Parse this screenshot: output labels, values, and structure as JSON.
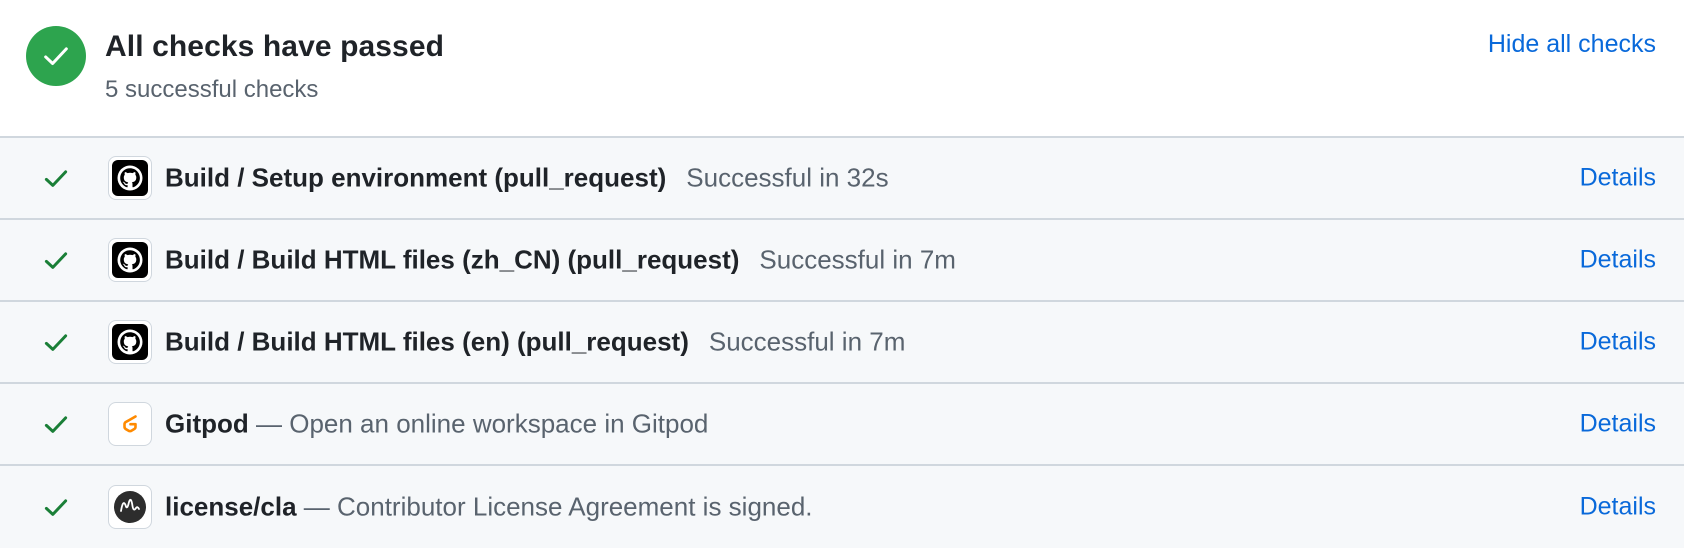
{
  "summary": {
    "title": "All checks have passed",
    "subtitle": "5 successful checks",
    "hide_label": "Hide all checks",
    "status_color": "#2da44e"
  },
  "checks": [
    {
      "name": "Build / Setup environment (pull_request)",
      "status": "Successful in 32s",
      "avatar_icon": "github-icon",
      "details_label": "Details"
    },
    {
      "name": "Build / Build HTML files (zh_CN) (pull_request)",
      "status": "Successful in 7m",
      "avatar_icon": "github-icon",
      "details_label": "Details"
    },
    {
      "name": "Build / Build HTML files (en) (pull_request)",
      "status": "Successful in 7m",
      "avatar_icon": "github-icon",
      "details_label": "Details"
    },
    {
      "name": "Gitpod",
      "separator": "—",
      "description": "Open an online workspace in Gitpod",
      "avatar_icon": "gitpod-icon",
      "details_label": "Details"
    },
    {
      "name": "license/cla",
      "separator": "—",
      "description": "Contributor License Agreement is signed.",
      "avatar_icon": "cla-assistant-icon",
      "details_label": "Details"
    }
  ],
  "colors": {
    "success": "#1a7f37",
    "link": "#0969da",
    "muted": "#59636e",
    "row_background": "#f6f8fa",
    "border": "#d0d7de",
    "gitpod_orange": "#ff8a00"
  }
}
